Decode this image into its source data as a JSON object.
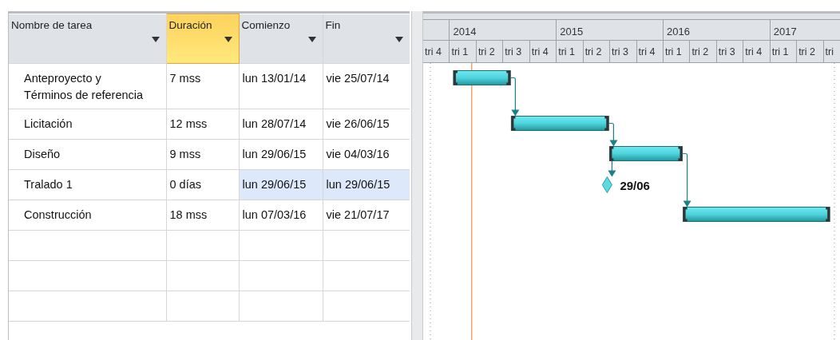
{
  "columns": [
    {
      "label": "Nombre de tarea",
      "selected": false
    },
    {
      "label": "Duración",
      "selected": true
    },
    {
      "label": "Comienzo",
      "selected": false
    },
    {
      "label": "Fin",
      "selected": false
    }
  ],
  "timescale": {
    "years": [
      {
        "label": "2014"
      },
      {
        "label": "2015"
      },
      {
        "label": "2016"
      },
      {
        "label": "2017"
      }
    ],
    "quarters": [
      {
        "label": "tri 4"
      },
      {
        "label": "tri 1"
      },
      {
        "label": "tri 2"
      },
      {
        "label": "tri 3"
      },
      {
        "label": "tri 4"
      },
      {
        "label": "tri 1"
      },
      {
        "label": "tri 2"
      },
      {
        "label": "tri 3"
      },
      {
        "label": "tri 4"
      },
      {
        "label": "tri 1"
      },
      {
        "label": "tri 2"
      },
      {
        "label": "tri 3"
      },
      {
        "label": "tri 4"
      },
      {
        "label": "tri 1"
      },
      {
        "label": "tri 2"
      },
      {
        "label": "tri"
      }
    ]
  },
  "tasks": [
    {
      "kind": "task",
      "name": "Anteproyecto y Términos de referencia",
      "duration": "7 mss",
      "start": "lun 13/01/14",
      "finish": "vie 25/07/14",
      "start_highlighted": false,
      "finish_highlighted": false,
      "linked": false
    },
    {
      "kind": "task",
      "name": "Licitación",
      "duration": "12 mss",
      "start": "lun 28/07/14",
      "finish": "vie 26/06/15",
      "start_highlighted": false,
      "finish_highlighted": false,
      "linked": true
    },
    {
      "kind": "task",
      "name": "Diseño",
      "duration": "9 mss",
      "start": "lun 29/06/15",
      "finish": "vie 04/03/16",
      "start_highlighted": false,
      "finish_highlighted": false,
      "linked": true
    },
    {
      "kind": "milestone",
      "name": "Tralado 1",
      "duration": "0 días",
      "start": "lun 29/06/15",
      "finish": "lun 29/06/15",
      "start_highlighted": true,
      "finish_highlighted": true,
      "linked": true,
      "bar_label": "29/06"
    },
    {
      "kind": "task",
      "name": "Construcción",
      "duration": "18 mss",
      "start": "lun 07/03/16",
      "finish": "vie 21/07/17",
      "start_highlighted": false,
      "finish_highlighted": false,
      "linked": true
    }
  ]
}
